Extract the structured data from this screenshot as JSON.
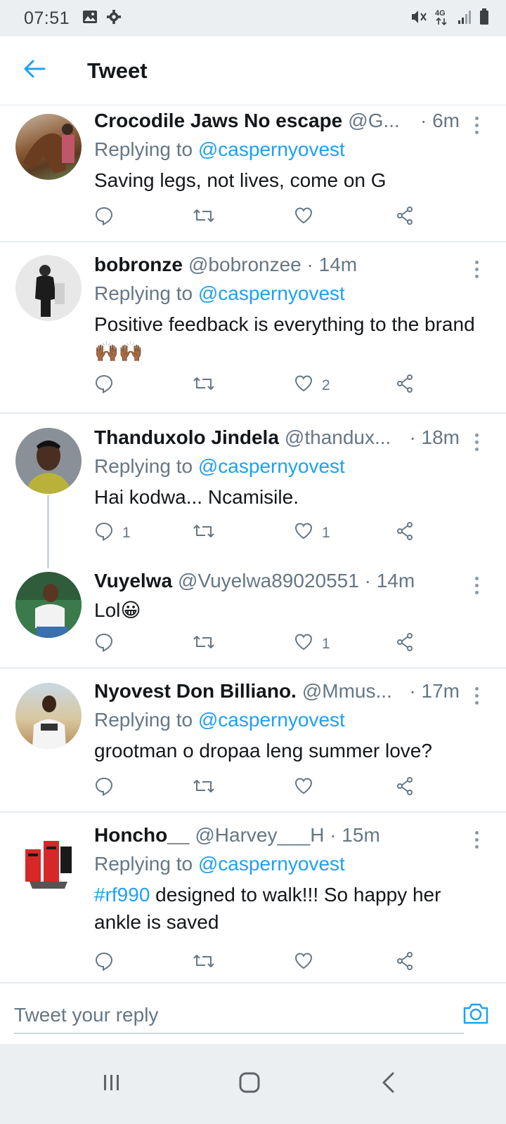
{
  "status_bar": {
    "time": "07:51",
    "network": "4G"
  },
  "header": {
    "title": "Tweet"
  },
  "tweets": [
    {
      "name": "Crocodile Jaws No escape",
      "handle": "@G...",
      "time": "· 6m",
      "replying_prefix": "Replying to ",
      "replying_to": "@caspernyovest",
      "text": "Saving legs, not lives, come on G",
      "reply_count": "",
      "like_count": ""
    },
    {
      "name": "bobronze",
      "handle": "@bobronzee · 14m",
      "time": "",
      "replying_prefix": "Replying to ",
      "replying_to": "@caspernyovest",
      "text": "Positive feedback is everything to the brand 🙌🏾🙌🏾",
      "reply_count": "",
      "like_count": "2"
    },
    {
      "name": "Thanduxolo Jindela",
      "handle": "@thandux...",
      "time": "· 18m",
      "replying_prefix": "Replying to ",
      "replying_to": "@caspernyovest",
      "text": "Hai kodwa... Ncamisile.",
      "reply_count": "1",
      "like_count": "1"
    },
    {
      "name": "Vuyelwa",
      "handle": "@Vuyelwa89020551 · 14m",
      "time": "",
      "text": "Lol😀",
      "reply_count": "",
      "like_count": "1"
    },
    {
      "name": "Nyovest Don Billiano.",
      "handle": "@Mmus...",
      "time": "· 17m",
      "replying_prefix": "Replying to ",
      "replying_to": "@caspernyovest",
      "text": "grootman o dropaa leng summer love?",
      "reply_count": "",
      "like_count": ""
    },
    {
      "name": "Honcho__",
      "handle": "@Harvey___H · 15m",
      "time": "",
      "replying_prefix": "Replying to ",
      "replying_to": "@caspernyovest",
      "hashtag": "#rf990",
      "text": " designed to walk!!! So happy her ankle is saved",
      "reply_count": "",
      "like_count": ""
    }
  ],
  "reply_bar": {
    "placeholder": "Tweet your reply"
  },
  "icons": {
    "back": "arrow-left-icon",
    "reply": "comment-icon",
    "retweet": "retweet-icon",
    "like": "heart-icon",
    "share": "share-icon",
    "more": "more-vertical-icon",
    "camera": "camera-icon"
  },
  "colors": {
    "accent": "#1da1f2",
    "secondary_text": "#657786",
    "primary_text": "#14171a",
    "divider": "#e6ecf0"
  }
}
